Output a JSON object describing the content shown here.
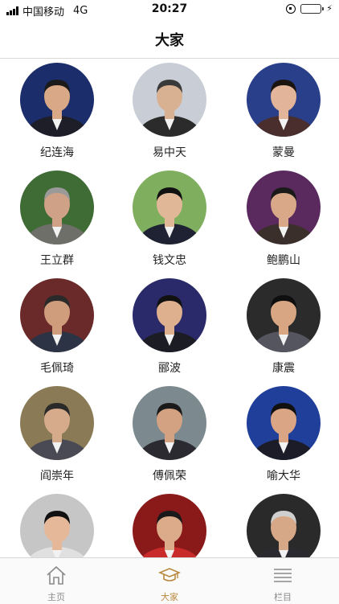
{
  "status_bar": {
    "carrier": "中国移动",
    "network": "4G",
    "time": "20:27"
  },
  "navbar": {
    "title": "大家"
  },
  "people": [
    {
      "name": "纪连海",
      "bg": "#1b2d6b",
      "skin": "#d9a987",
      "suit": "#1e1e28",
      "hair": "#1a1a1a"
    },
    {
      "name": "易中天",
      "bg": "#c9ced6",
      "skin": "#d8b092",
      "suit": "#2b2b2b",
      "hair": "#3a3a3a"
    },
    {
      "name": "蒙曼",
      "bg": "#2a3f8a",
      "skin": "#e2b59a",
      "suit": "#4a2e2e",
      "hair": "#1a1410"
    },
    {
      "name": "王立群",
      "bg": "#3f6b35",
      "skin": "#cfa186",
      "suit": "#6f6f6a",
      "hair": "#9a9a9a"
    },
    {
      "name": "钱文忠",
      "bg": "#7fae5e",
      "skin": "#e0b898",
      "suit": "#1f2233",
      "hair": "#111111"
    },
    {
      "name": "鲍鹏山",
      "bg": "#5a2a5e",
      "skin": "#d8a888",
      "suit": "#3a2f2a",
      "hair": "#1a1a1a"
    },
    {
      "name": "毛佩琦",
      "bg": "#6a2a2a",
      "skin": "#cf9c7c",
      "suit": "#2b3344",
      "hair": "#2a2a2a"
    },
    {
      "name": "郦波",
      "bg": "#2a2a6a",
      "skin": "#deb08e",
      "suit": "#1c1c24",
      "hair": "#111111"
    },
    {
      "name": "康震",
      "bg": "#2b2b2b",
      "skin": "#d8a683",
      "suit": "#555560",
      "hair": "#0f0f0f"
    },
    {
      "name": "阎崇年",
      "bg": "#8a7a55",
      "skin": "#d6ab8c",
      "suit": "#4a4a55",
      "hair": "#2a2a2a"
    },
    {
      "name": "傅佩荣",
      "bg": "#7c8a8f",
      "skin": "#d2a283",
      "suit": "#2a2a30",
      "hair": "#1a1a1a"
    },
    {
      "name": "喻大华",
      "bg": "#1f3f9a",
      "skin": "#d9a584",
      "suit": "#1c1c28",
      "hair": "#111111"
    },
    {
      "name": "",
      "bg": "#c6c6c6",
      "skin": "#e5b899",
      "suit": "#e0e0e0",
      "hair": "#111111"
    },
    {
      "name": "",
      "bg": "#8a1a1a",
      "skin": "#dbab8a",
      "suit": "#c92a2a",
      "hair": "#1a1a1a"
    },
    {
      "name": "",
      "bg": "#2a2a2a",
      "skin": "#d7a887",
      "suit": "#2a2a30",
      "hair": "#cfcfcf"
    }
  ],
  "tabs": [
    {
      "label": "主页",
      "icon": "home-icon",
      "active": false
    },
    {
      "label": "大家",
      "icon": "graduation-cap-icon",
      "active": true
    },
    {
      "label": "栏目",
      "icon": "list-icon",
      "active": false
    }
  ],
  "colors": {
    "accent": "#b8893e",
    "inactive": "#8a8a8a"
  }
}
